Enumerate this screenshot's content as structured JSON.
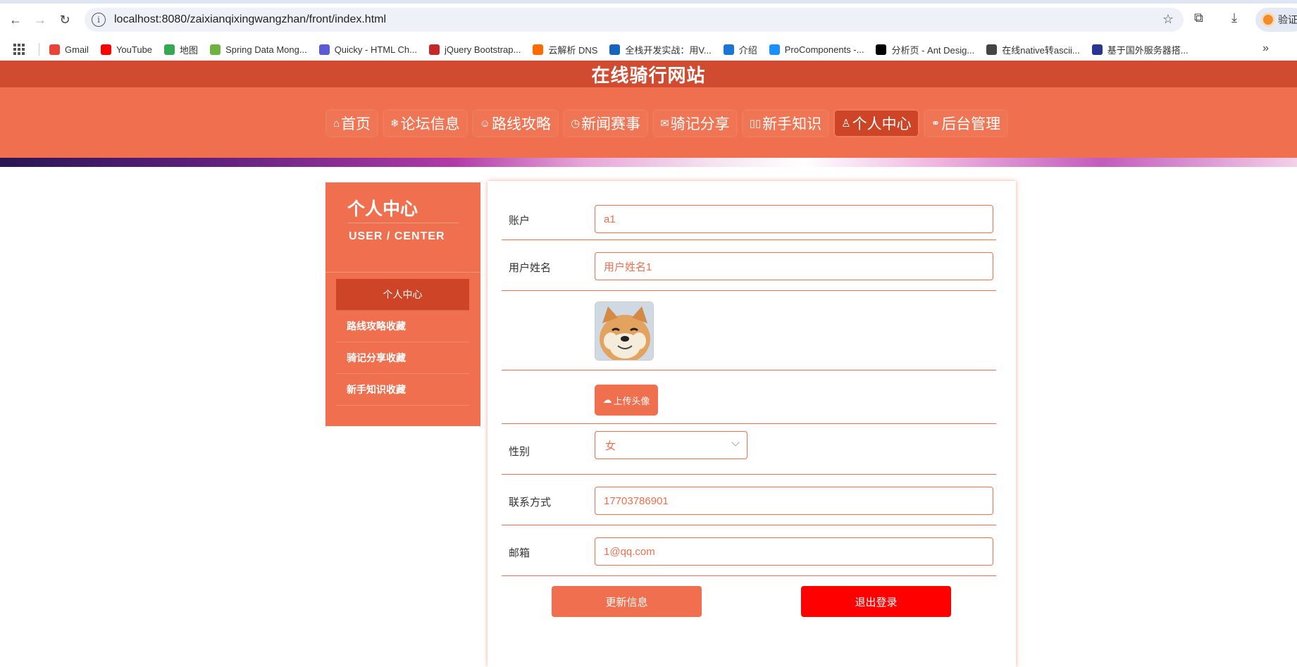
{
  "browser": {
    "url": "localhost:8080/zaixianqixingwangzhan/front/index.html",
    "profile_label": "验证"
  },
  "bookmarks": [
    {
      "label": "Gmail",
      "color": "#ea4335"
    },
    {
      "label": "YouTube",
      "color": "#ff0000"
    },
    {
      "label": "地图",
      "color": "#34a853"
    },
    {
      "label": "Spring Data Mong...",
      "color": "#6db33f"
    },
    {
      "label": "Quicky - HTML Ch...",
      "color": "#5b5bd6"
    },
    {
      "label": "jQuery Bootstrap...",
      "color": "#c62828"
    },
    {
      "label": "云解析 DNS",
      "color": "#ff6a00"
    },
    {
      "label": "全栈开发实战：用V...",
      "color": "#1565c0"
    },
    {
      "label": "介绍",
      "color": "#1976d2"
    },
    {
      "label": "ProComponents -...",
      "color": "#1890ff"
    },
    {
      "label": "分析页 - Ant Desig...",
      "color": "#000000"
    },
    {
      "label": "在线native转ascii...",
      "color": "#444444"
    },
    {
      "label": "基于国外服务器搭...",
      "color": "#283593"
    }
  ],
  "site": {
    "title": "在线骑行网站",
    "nav": [
      {
        "icon": "⌂",
        "label": "首页"
      },
      {
        "icon": "❄",
        "label": "论坛信息"
      },
      {
        "icon": "☺",
        "label": "路线攻略"
      },
      {
        "icon": "◷",
        "label": "新闻赛事"
      },
      {
        "icon": "✉",
        "label": "骑记分享"
      },
      {
        "icon": "▯▯",
        "label": "新手知识"
      },
      {
        "icon": "♙",
        "label": "个人中心"
      },
      {
        "icon": "⚭",
        "label": "后台管理"
      }
    ]
  },
  "sidebar": {
    "title": "个人中心",
    "subtitle": "USER / CENTER",
    "items": [
      "个人中心",
      "路线攻略收藏",
      "骑记分享收藏",
      "新手知识收藏"
    ]
  },
  "form": {
    "account_label": "账户",
    "account_value": "a1",
    "name_label": "用户姓名",
    "name_value": "用户姓名1",
    "upload_label": "上传头像",
    "gender_label": "性别",
    "gender_value": "女",
    "phone_label": "联系方式",
    "phone_value": "17703786901",
    "email_label": "邮箱",
    "email_value": "1@qq.com",
    "update_button": "更新信息",
    "logout_button": "退出登录"
  },
  "colors": {
    "primary": "#ef6f4e",
    "title_bar": "#d14b30",
    "active": "#cd4427",
    "logout": "#ff0000"
  }
}
